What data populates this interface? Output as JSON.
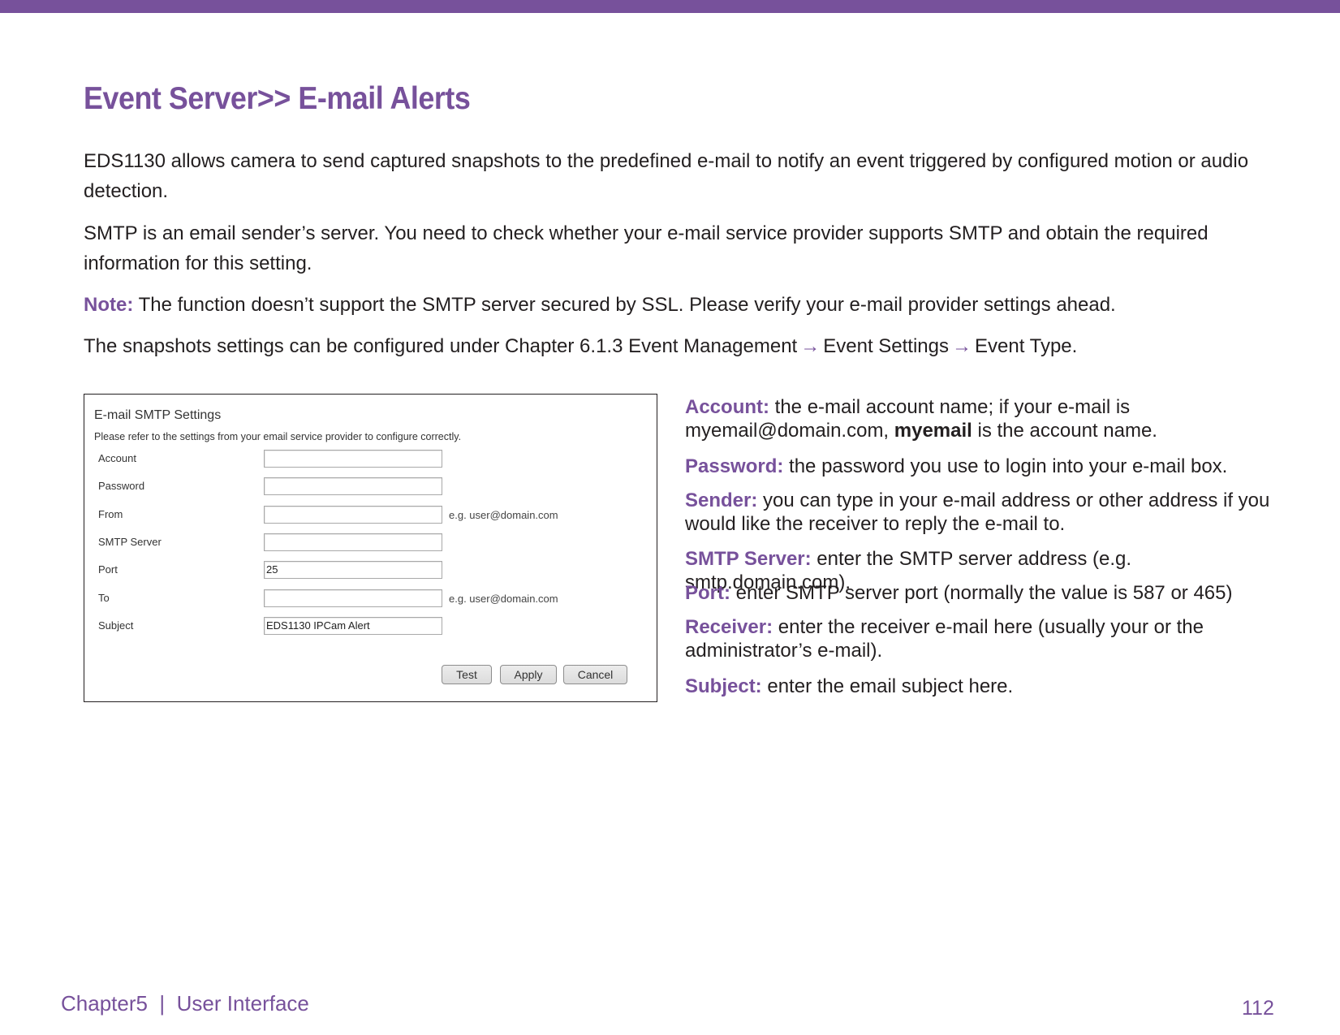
{
  "header": {
    "title": "Event Server>> E-mail Alerts",
    "accent_color": "#77519b"
  },
  "intro": {
    "paragraph1": "EDS1130 allows camera to send captured snapshots to the predefined e-mail to notify an event triggered by configured motion or audio detection.",
    "paragraph2": "SMTP is an email sender’s server. You need to check whether your e-mail service provider supports SMTP and obtain the required information for this setting.",
    "note_label": "Note:",
    "note_text": " The function doesn’t support the SMTP server secured by SSL. Please verify your e-mail provider settings ahead.",
    "path_prefix": "The snapshots settings can be configured under Chapter 6.1.3 Event Management",
    "path_step2": "Event Settings",
    "path_step3": "Event Type.",
    "arrow_icon": "→"
  },
  "smtp_form": {
    "title": "E-mail SMTP Settings",
    "subtitle": "Please refer to the settings from your email service provider to configure correctly.",
    "fields": [
      {
        "label": "Account",
        "value": "",
        "hint": ""
      },
      {
        "label": "Password",
        "value": "",
        "hint": ""
      },
      {
        "label": "From",
        "value": "",
        "hint": "e.g. user@domain.com"
      },
      {
        "label": "SMTP Server",
        "value": "",
        "hint": ""
      },
      {
        "label": "Port",
        "value": "25",
        "hint": ""
      },
      {
        "label": "To",
        "value": "",
        "hint": "e.g. user@domain.com"
      },
      {
        "label": "Subject",
        "value": "EDS1130 IPCam Alert",
        "hint": ""
      }
    ],
    "buttons": {
      "test": "Test",
      "apply": "Apply",
      "cancel": "Cancel"
    }
  },
  "descriptions": [
    {
      "key": "Account:",
      "text": " the e-mail account name; if your e-mail is myemail@domain.com, ",
      "bold": "myemail",
      "after": " is the account name."
    },
    {
      "key": "Password:",
      "text": " the password you use to login into your e-mail box."
    },
    {
      "key": "Sender:",
      "text": " you can type in your e-mail address or other address if you would like the receiver to reply the e-mail to."
    },
    {
      "key": "SMTP Server:",
      "text": " enter the SMTP server address (e.g. smtp.domain.com)."
    },
    {
      "key": "Port:",
      "text": " enter SMTP server port (normally the value is 587 or 465)"
    },
    {
      "key": "Receiver:",
      "text": " enter the receiver e-mail here (usually your or the administrator’s e-mail)."
    },
    {
      "key": "Subject:",
      "text": " enter the email subject here."
    }
  ],
  "footer": {
    "chapter": "Chapter5  |  User Interface",
    "page_number": "112"
  }
}
